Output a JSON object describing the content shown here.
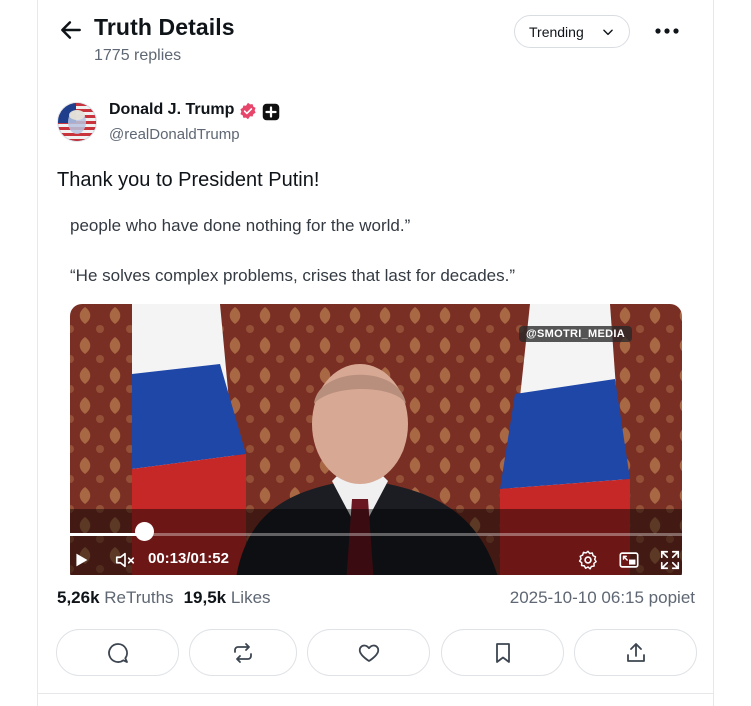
{
  "header": {
    "title": "Truth Details",
    "subtitle": "1775 replies",
    "sort_label": "Trending"
  },
  "post": {
    "author_name": "Donald J. Trump",
    "author_handle": "@realDonaldTrump",
    "text": "Thank you to President Putin!",
    "media": {
      "quote_line_1": "people who have done nothing for the world.”",
      "quote_line_2": "“He solves complex problems, crises that last for decades.”",
      "watermark": "@SMOTRI_MEDIA",
      "time_current": "00:13",
      "time_total": "01:52",
      "progress": 0.116
    },
    "retruths_count": "5,26k",
    "retruths_label": "ReTruths",
    "likes_count": "19,5k",
    "likes_label": "Likes",
    "timestamp": "2025-10-10 06:15 popiet"
  },
  "colors": {
    "verified": "#e8456b",
    "text": "#0f1419",
    "muted": "#5e6773",
    "border": "#dfe2e6"
  },
  "icons": [
    "back-arrow-icon",
    "chevron-down-icon",
    "more-icon",
    "verified-icon",
    "plus-badge-icon",
    "play-icon",
    "mute-icon",
    "settings-icon",
    "pip-icon",
    "fullscreen-icon",
    "reply-icon",
    "retruth-icon",
    "like-icon",
    "bookmark-icon",
    "share-icon"
  ]
}
